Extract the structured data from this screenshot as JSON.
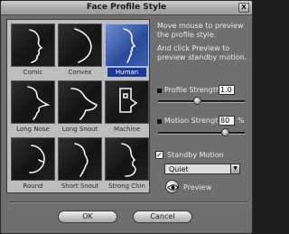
{
  "window": {
    "title": "Face Profile Style",
    "close_glyph": "x"
  },
  "profiles": [
    {
      "label": "Comic",
      "icon": "comic-profile-icon",
      "selected": false
    },
    {
      "label": "Convex",
      "icon": "convex-profile-icon",
      "selected": false
    },
    {
      "label": "Human",
      "icon": "human-profile-icon",
      "selected": true
    },
    {
      "label": "Long Nose",
      "icon": "long-nose-profile-icon",
      "selected": false
    },
    {
      "label": "Long Snout",
      "icon": "long-snout-profile-icon",
      "selected": false
    },
    {
      "label": "Machine",
      "icon": "machine-profile-icon",
      "selected": false
    },
    {
      "label": "Round",
      "icon": "round-profile-icon",
      "selected": false
    },
    {
      "label": "Short Snout",
      "icon": "short-snout-profile-icon",
      "selected": false
    },
    {
      "label": "Strong Chin",
      "icon": "strong-chin-profile-icon",
      "selected": false
    }
  ],
  "help": {
    "line1": "Move mouse to preview the profile style.",
    "line2": "And click Preview to preview standby motion."
  },
  "profile_strength": {
    "label": "Profile Strength",
    "value": "1.0",
    "level": 0.45
  },
  "motion_strength": {
    "label": "Motion Strength",
    "value": "80",
    "unit": "%",
    "level": 0.8
  },
  "standby_motion": {
    "label": "Standby Motion",
    "checked": true,
    "check_glyph": "✓"
  },
  "motion_select": {
    "value": "Quiet",
    "arrow": "▼"
  },
  "preview": {
    "label": "Preview",
    "icon": "eye-icon"
  },
  "buttons": {
    "ok": "OK",
    "cancel": "Cancel"
  },
  "colors": {
    "selected_thumb": "#2a4a9a",
    "selected_caption": "#1a3a9a"
  }
}
